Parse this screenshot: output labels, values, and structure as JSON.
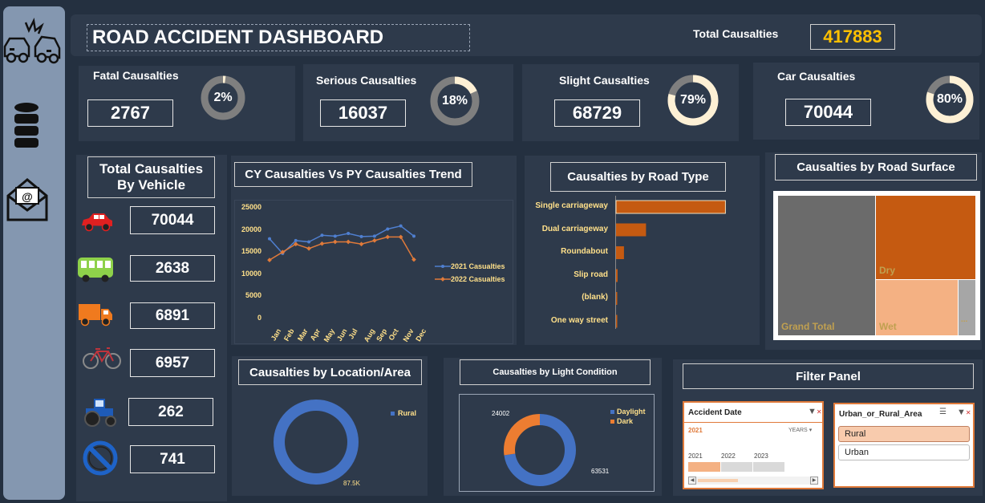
{
  "header": {
    "title": "ROAD ACCIDENT DASHBOARD",
    "total_label": "Total Causalties",
    "total_value": "417883"
  },
  "sidebar": {
    "icons": [
      "car-crash-icon",
      "database-icon",
      "email-icon"
    ]
  },
  "kpis": [
    {
      "label": "Fatal Causalties",
      "value": "2767",
      "pct_label": "2%",
      "pct": 0.02
    },
    {
      "label": "Serious Causalties",
      "value": "16037",
      "pct_label": "18%",
      "pct": 0.18
    },
    {
      "label": "Slight Causalties",
      "value": "68729",
      "pct_label": "79%",
      "pct": 0.79
    },
    {
      "label": "Car Causalties",
      "value": "70044",
      "pct_label": "80%",
      "pct": 0.8
    }
  ],
  "vehicles": {
    "title": "Total Causalties By Vehicle",
    "items": [
      {
        "icon": "car-icon",
        "value": "70044",
        "color": "#e02020"
      },
      {
        "icon": "bus-icon",
        "value": "2638",
        "color": "#8ed14a"
      },
      {
        "icon": "truck-icon",
        "value": "6891",
        "color": "#f07a1e"
      },
      {
        "icon": "bicycle-icon",
        "value": "6957",
        "color": "#c0343c"
      },
      {
        "icon": "tractor-icon",
        "value": "262",
        "color": "#1e5bb8"
      },
      {
        "icon": "no-entry-icon",
        "value": "741",
        "color": "#1e63c8"
      }
    ]
  },
  "trend": {
    "title": "CY Causalties Vs PY Causalties Trend",
    "chart_data": {
      "type": "line",
      "categories": [
        "Jan",
        "Feb",
        "Mar",
        "Apr",
        "May",
        "Jun",
        "Jul",
        "Aug",
        "Sep",
        "Oct",
        "Nov",
        "Dec"
      ],
      "ylim": [
        0,
        25000
      ],
      "yticks": [
        "25000",
        "20000",
        "15000",
        "10000",
        "5000",
        "0"
      ],
      "series": [
        {
          "name": "2021 Casualties",
          "color": "#4f7fd0",
          "values": [
            18000,
            14700,
            17600,
            17300,
            18800,
            18600,
            19200,
            18500,
            18600,
            20200,
            20900,
            18600
          ]
        },
        {
          "name": "2022 Casualties",
          "color": "#e07a3a",
          "values": [
            13200,
            15000,
            16800,
            15800,
            16900,
            17300,
            17300,
            16800,
            17600,
            18400,
            18400,
            13300
          ]
        }
      ]
    }
  },
  "road_type": {
    "title": "Causalties by Road Type",
    "chart_data": {
      "type": "bar",
      "categories": [
        "Single carriageway",
        "Dual carriageway",
        "Roundabout",
        "Slip road",
        "(blank)",
        "One way street"
      ],
      "values": [
        62000,
        17000,
        4500,
        900,
        200,
        300
      ],
      "xlim": [
        0,
        70000
      ],
      "color": "#c55a11"
    }
  },
  "road_surface": {
    "title": "Causalties by Road Surface",
    "chart_data": {
      "type": "treemap",
      "items": [
        {
          "label": "Grand Total",
          "color": "#6b6b6b"
        },
        {
          "label": "Dry",
          "color": "#c55a11"
        },
        {
          "label": "Wet",
          "color": "#f4b183"
        },
        {
          "label": "...",
          "color": "#a6a6a6"
        }
      ]
    }
  },
  "location": {
    "title": "Causalties by  Location/Area",
    "chart_data": {
      "type": "pie",
      "labels": [
        "Rural"
      ],
      "values": [
        87500
      ],
      "value_labels": [
        "87.5K"
      ],
      "colors": [
        "#4472c4"
      ]
    }
  },
  "light": {
    "title": "Causalties by Light Condition",
    "chart_data": {
      "type": "pie",
      "labels": [
        "Daylight",
        "Dark"
      ],
      "values": [
        63531,
        24002
      ],
      "value_labels": [
        "63531",
        "24002"
      ],
      "colors": [
        "#4472c4",
        "#ed7d31"
      ]
    }
  },
  "filter": {
    "title": "Filter Panel",
    "date_slicer": {
      "title": "Accident Date",
      "selected": "2021",
      "level": "YEARS",
      "years": [
        "2021",
        "2022",
        "2023"
      ]
    },
    "area_slicer": {
      "title": "Urban_or_Rural_Area",
      "options": [
        "Rural",
        "Urban"
      ]
    }
  }
}
